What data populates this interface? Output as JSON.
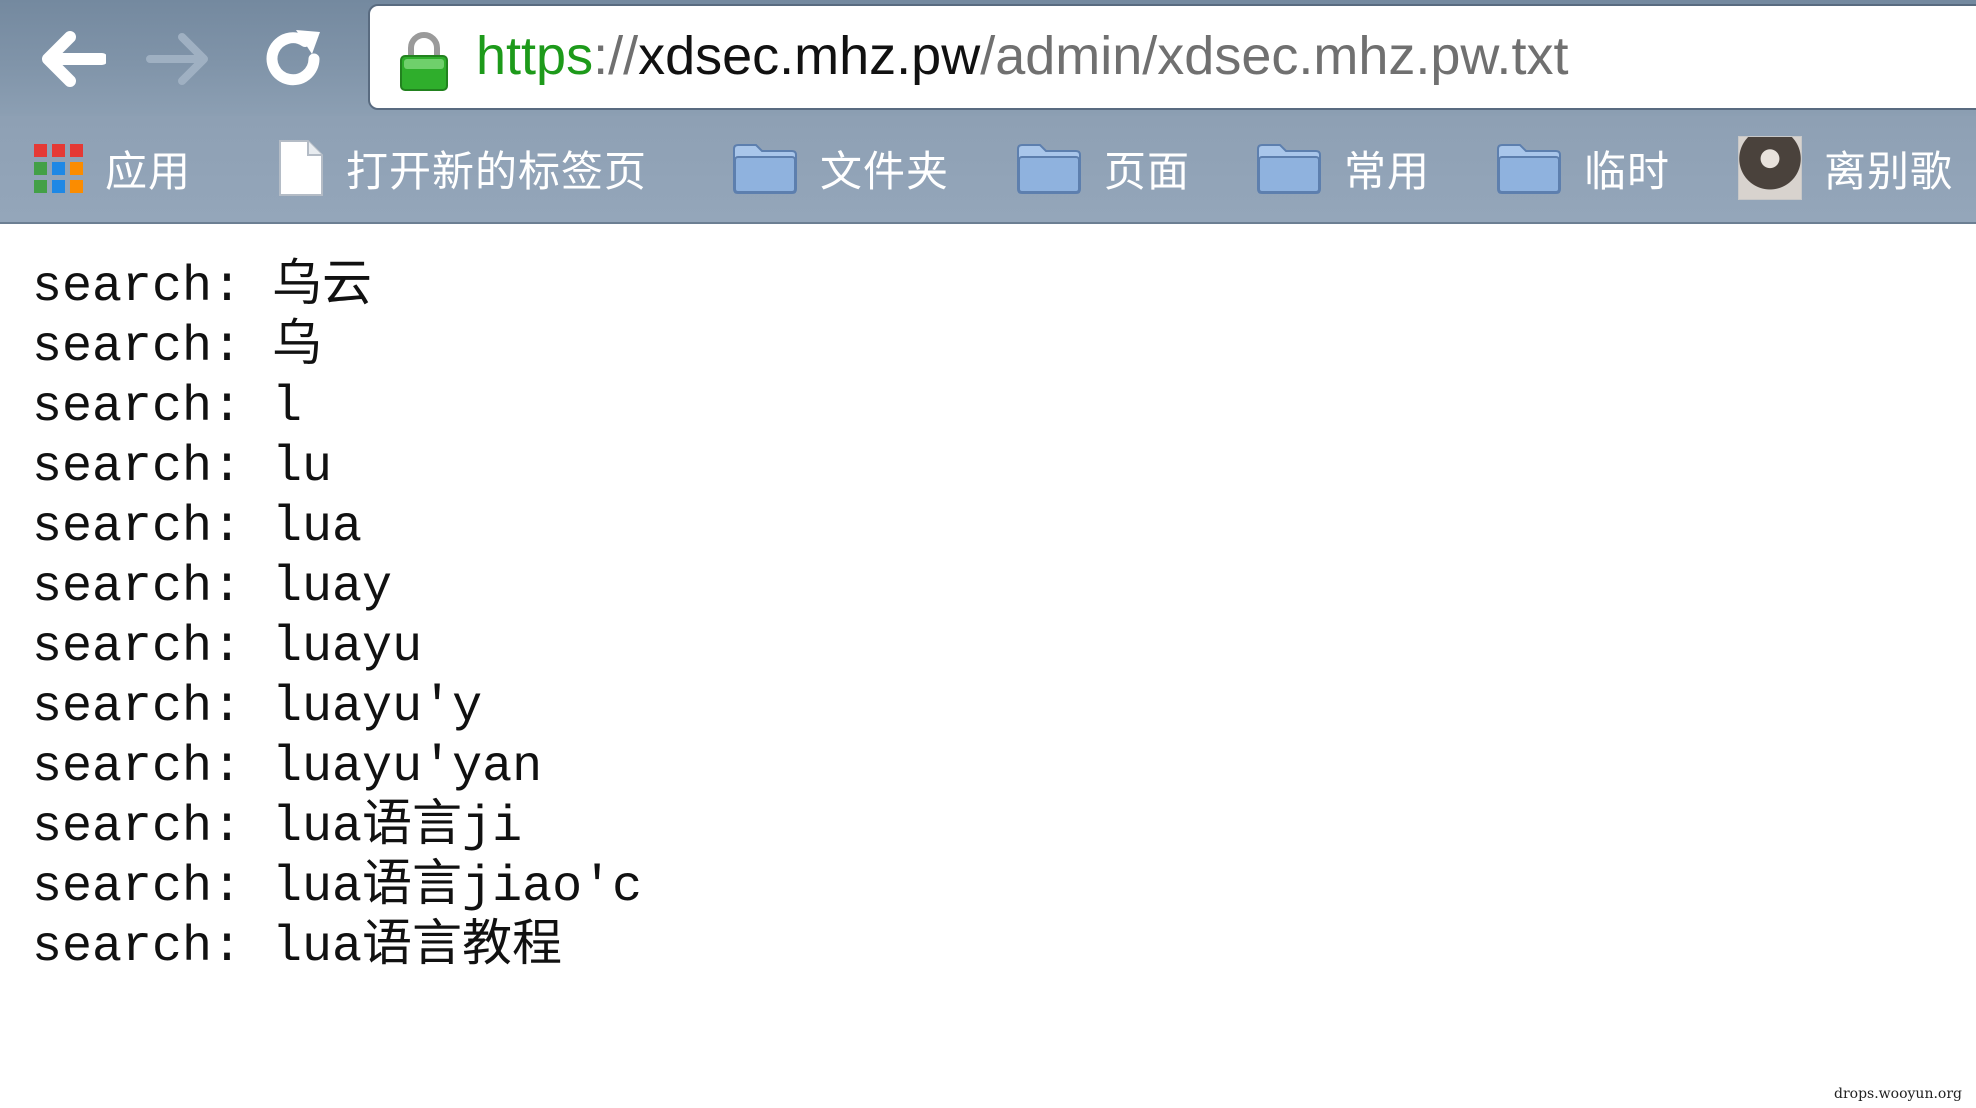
{
  "browser": {
    "nav": {
      "back_icon": "back-arrow-icon",
      "forward_icon": "forward-arrow-icon",
      "reload_icon": "reload-icon"
    },
    "omnibox": {
      "secure_icon": "lock-icon",
      "scheme": "https",
      "separator": "://",
      "host": "xdsec.mhz.pw",
      "path": "/admin/xdsec.mhz.pw.txt",
      "scheme_color": "#1d9a1a"
    },
    "bookmarks": [
      {
        "label": "应用",
        "icon": "apps-grid-icon"
      },
      {
        "label": "打开新的标签页",
        "icon": "page-icon"
      },
      {
        "label": "文件夹",
        "icon": "folder-icon"
      },
      {
        "label": "页面",
        "icon": "folder-icon"
      },
      {
        "label": "常用",
        "icon": "folder-icon"
      },
      {
        "label": "临时",
        "icon": "folder-icon"
      },
      {
        "label": "离别歌",
        "icon": "avatar-icon"
      }
    ]
  },
  "page": {
    "lines": [
      {
        "prefix": "search: ",
        "value": "乌云"
      },
      {
        "prefix": "search: ",
        "value": "乌"
      },
      {
        "prefix": "search: ",
        "value": "l"
      },
      {
        "prefix": "search: ",
        "value": "lu"
      },
      {
        "prefix": "search: ",
        "value": "lua"
      },
      {
        "prefix": "search: ",
        "value": "luay"
      },
      {
        "prefix": "search: ",
        "value": "luayu"
      },
      {
        "prefix": "search: ",
        "value": "luayu'y"
      },
      {
        "prefix": "search: ",
        "value": "luayu'yan"
      },
      {
        "prefix": "search: ",
        "value": "lua语言ji"
      },
      {
        "prefix": "search: ",
        "value": "lua语言jiao'c"
      },
      {
        "prefix": "search: ",
        "value": "lua语言教程"
      }
    ]
  },
  "watermark": "drops.wooyun.org"
}
